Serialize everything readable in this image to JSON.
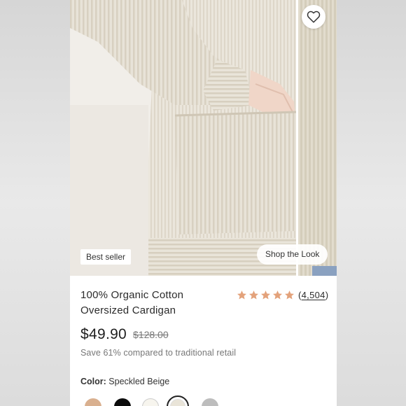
{
  "product": {
    "title_line1": "100% Organic Cotton",
    "title_line2": "Oversized Cardigan",
    "price": "$49.90",
    "original_price": "$128.00",
    "savings_text": "Save 61% compared to traditional retail",
    "rating": 5,
    "review_count": "4,504",
    "badge": "Best seller",
    "color_label": "Color:",
    "color_value": "Speckled Beige"
  },
  "gallery": {
    "shop_the_look": "Shop the Look",
    "favorite_icon": "heart-outline-icon"
  },
  "swatches": [
    {
      "name": "tan",
      "color": "#d9b08f"
    },
    {
      "name": "black",
      "color": "#0c0c0c"
    },
    {
      "name": "ivory",
      "color": "#f7f5ee"
    },
    {
      "name": "speckled-beige",
      "color": "#e9e4d8",
      "selected": true
    },
    {
      "name": "heather-grey",
      "color": "#bdbdbd"
    }
  ],
  "colors": {
    "star": "#e3a27b",
    "knit": "#e6e0d4"
  }
}
